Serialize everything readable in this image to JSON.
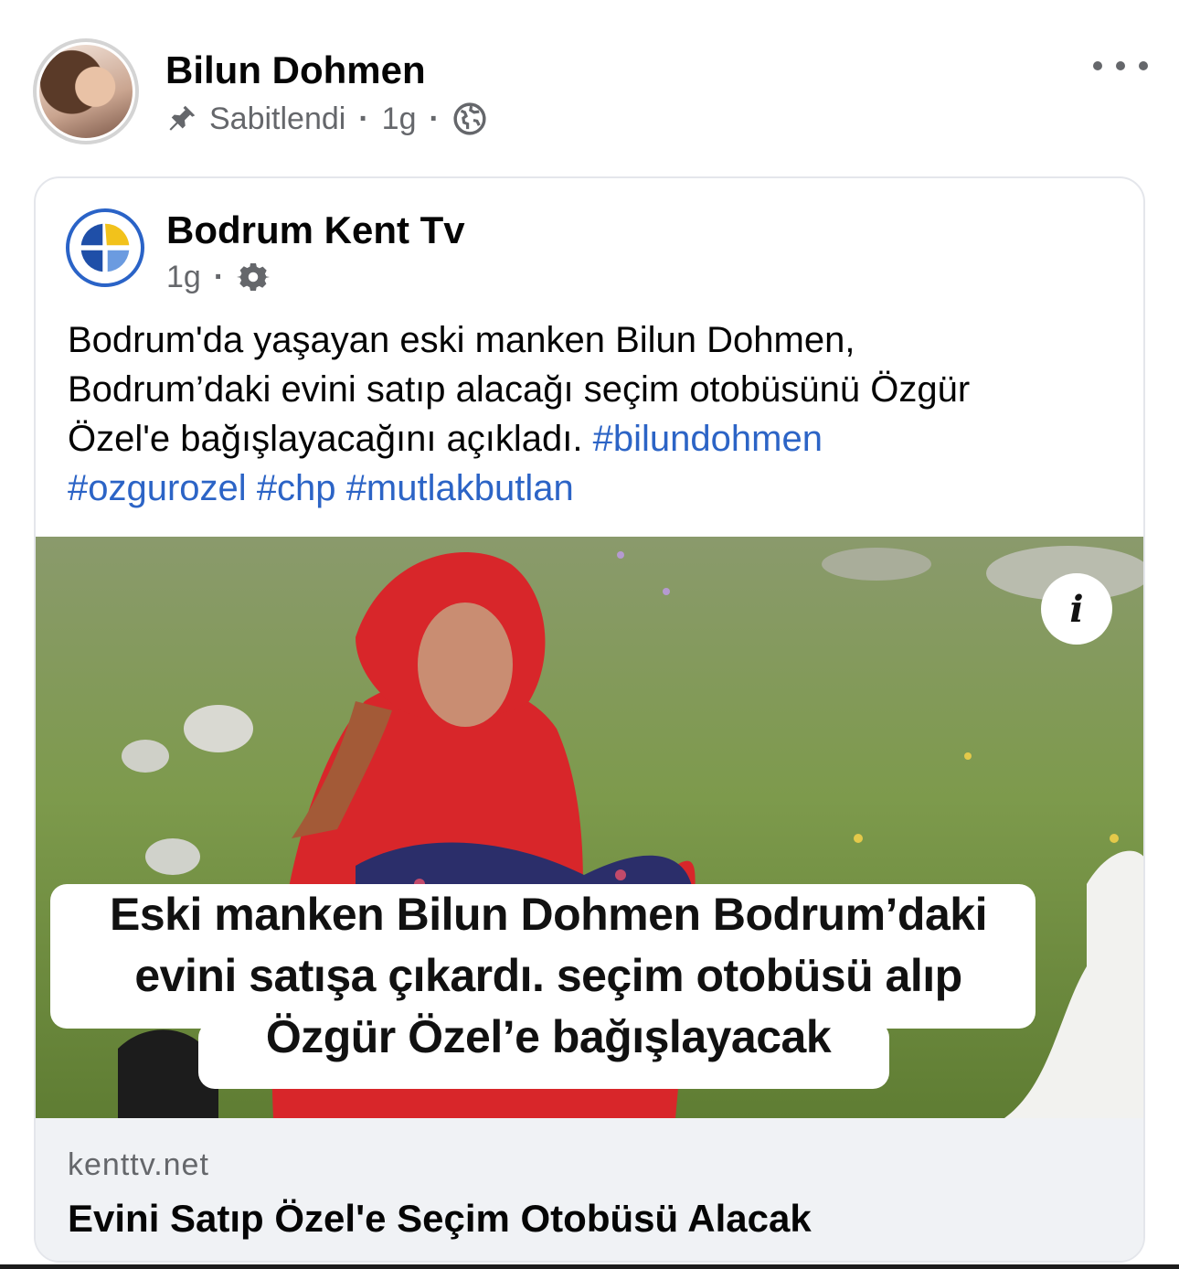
{
  "post": {
    "author": "Bilun Dohmen",
    "pinned_label": "Sabitlendi",
    "time": "1g",
    "audience_icon": "globe-icon",
    "pin_icon": "pin-icon",
    "more_icon": "more-horizontal-icon"
  },
  "shared": {
    "page_name": "Bodrum Kent Tv",
    "time": "1g",
    "settings_icon": "gear-icon",
    "text_lines": [
      "Bodrum'da yaşayan eski manken Bilun Dohmen,",
      "Bodrum’daki evini satıp alacağı seçim otobüsünü Özgür",
      "Özel'e bağışlayacağını açıkladı. "
    ],
    "hashtags": [
      "#bilundohmen",
      "#ozgurozel",
      "#chp",
      "#mutlakbutlan"
    ],
    "image": {
      "info_label": "i",
      "caption_lines": [
        "Eski manken Bilun Dohmen Bodrum’daki",
        "evini satışa çıkardı. seçim otobüsü alıp",
        "Özgür Özel’e  bağışlayacak"
      ]
    },
    "link": {
      "domain": "kenttv.net",
      "title": "Evini Satıp Özel'e Seçim Otobüsü Alacak"
    }
  },
  "colors": {
    "hashtag": "#2c64c6",
    "secondary_text": "#65676b",
    "link_footer_bg": "#f0f2f5",
    "scarf_red": "#d8262a"
  }
}
